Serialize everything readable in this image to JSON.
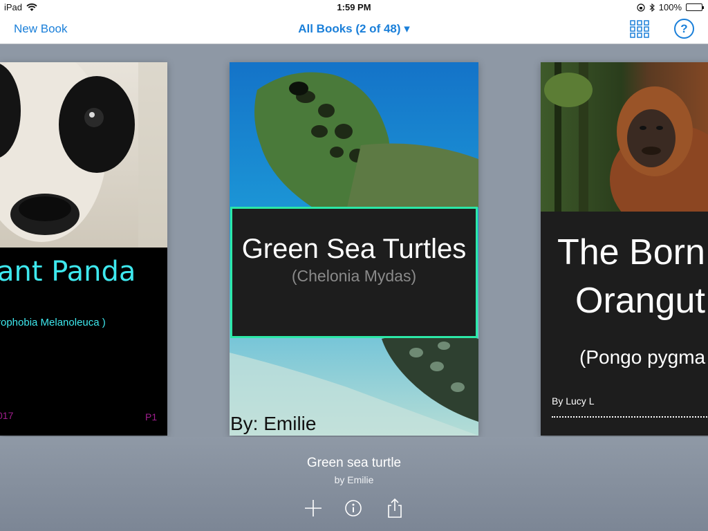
{
  "status_bar": {
    "device": "iPad",
    "time": "1:59 PM",
    "battery": "100%"
  },
  "nav": {
    "new_book_label": "New Book",
    "title": "All Books (2 of 48) ▾",
    "grid_icon": "grid-view-icon",
    "help_label": "?"
  },
  "books": [
    {
      "title": "ant Panda",
      "subtitle": "rophobia Melanoleuca )",
      "year": "017",
      "page": "P1"
    },
    {
      "title": "Green Sea Turtles",
      "subtitle": "(Chelonia Mydas)",
      "author_line": "By: Emilie"
    },
    {
      "title_line1": "The Born",
      "title_line2": "Orangut",
      "subtitle": "(Pongo pygma",
      "author_line": "By Lucy L"
    }
  ],
  "selected_book": {
    "title": "Green sea turtle",
    "author": "by Emilie"
  },
  "actions": {
    "add_icon": "plus-icon",
    "info_icon": "info-icon",
    "share_icon": "share-icon"
  },
  "colors": {
    "accent": "#1a7fd9",
    "turtle_border": "#2ce8a7",
    "panda_text": "#3ee8ee",
    "panda_footer": "#a11e8f",
    "shelf_bg": "#8e98a5"
  }
}
